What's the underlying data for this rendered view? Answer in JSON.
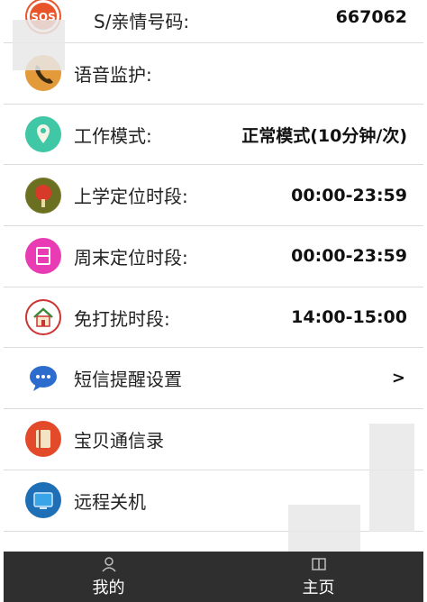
{
  "rows": [
    {
      "label": "S/亲情号码:",
      "value": "667062",
      "icon": "sos-icon"
    },
    {
      "label": "语音监护:",
      "value": "",
      "icon": "phone-icon"
    },
    {
      "label": "工作模式:",
      "value": "正常模式(10分钟/次)",
      "icon": "location-pin-icon"
    },
    {
      "label": "上学定位时段:",
      "value": "00:00-23:59",
      "icon": "school-tree-icon"
    },
    {
      "label": "周末定位时段:",
      "value": "00:00-23:59",
      "icon": "calendar-icon"
    },
    {
      "label": "免打扰时段:",
      "value": "14:00-15:00",
      "icon": "house-icon"
    },
    {
      "label": "短信提醒设置",
      "value": ">",
      "icon": "chat-bubble-icon"
    },
    {
      "label": "宝贝通信录",
      "value": "",
      "icon": "contacts-book-icon"
    },
    {
      "label": "远程关机",
      "value": "",
      "icon": "remote-shutdown-icon"
    }
  ],
  "tabs": [
    {
      "label": "我的",
      "icon": "person-icon"
    },
    {
      "label": "主页",
      "icon": "home-book-icon"
    }
  ],
  "colors": {
    "tabbar_bg": "#2f2f2f",
    "divider": "#dcdcdc",
    "sos_orange": "#e8552a",
    "phone_orange": "#e39a3b",
    "pin_teal": "#3fc7a6",
    "calendar_pink": "#e93bb4",
    "chat_blue": "#2b6ccc"
  }
}
